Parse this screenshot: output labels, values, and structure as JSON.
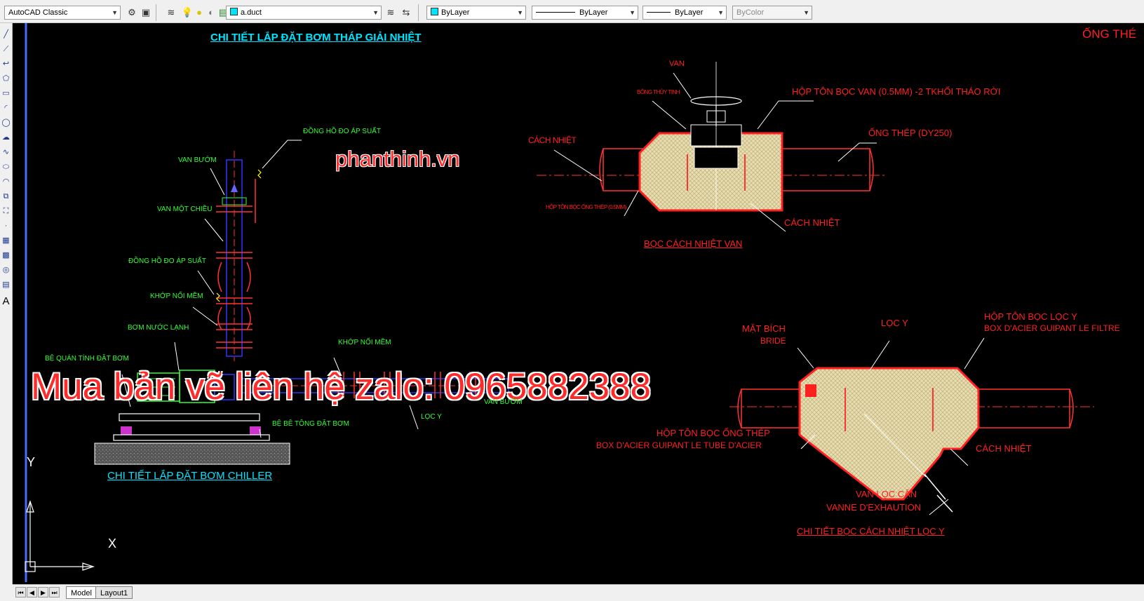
{
  "toolbar": {
    "workspace": "AutoCAD Classic",
    "layer": "a.duct",
    "color": "ByLayer",
    "linetype": "ByLayer",
    "lineweight": "ByLayer",
    "plotstyle": "ByColor"
  },
  "drawing": {
    "title_top_left": "CHI TIẾT LẮP ĐẶT BƠM THÁP GIẢI NHIỆT",
    "title_corner": "ỐNG THÉ",
    "watermark_site": "phanthinh.vn",
    "watermark_contact": "Mua bản vẽ liên hệ zalo: 0965882388",
    "pump_labels": {
      "dong_ho_top": "ĐỒNG HỒ ĐO ÁP SUẤT",
      "van_buom": "VAN BƯỚM",
      "van_mot_chieu": "VAN MỘT CHIỀU",
      "dong_ho_mid": "ĐỒNG HỒ ĐO ÁP SUẤT",
      "khop_noi_mem_1": "KHỚP NỐI MỀM",
      "bom_nuoc_lanh": "BƠM NƯỚC LẠNH",
      "khop_noi_mem_2": "KHỚP NỐI MỀM",
      "be_quan_tinh": "BỆ QUÁN TÍNH ĐẶT BƠM",
      "van_buom_2": "VAN BƯỚM",
      "loc_y": "LỌC Y",
      "be_be_tong": "BỆ BÊ TÔNG ĐẶT BƠM"
    },
    "title_chiller": "CHI TIẾT LẮP ĐẶT BƠM CHILLER",
    "valve_labels": {
      "van": "VAN",
      "bong_thuy_tinh": "BÔNG THỦY TINH",
      "hop_ton_boc_van": "HỘP TÔN BỌC VAN (0.5MM) -2 TKHỐI THÁO RỜI",
      "ong_thep": "ỐNG THÉP (DY250)",
      "cach_nhiet_1": "CÁCH NHIỆT",
      "hop_ton_boc_ong": "HỘP TÔN BỌC ỐNG THÉP (0.5MM)",
      "cach_nhiet_2": "CÁCH NHIỆT"
    },
    "title_valve": "BỌC CÁCH NHIỆT VAN",
    "filter_labels": {
      "mat_bich": "MẶT BÍCH",
      "bride": "BRIDE",
      "loc_y": "LỌC Y",
      "hop_ton_boc_loc_y": "HỘP TÔN BỌC LỌC Y",
      "box_filtre": "BOX D'ACIER GUIPANT LE FILTRE",
      "hop_ton_boc_ong_thep": "HỘP TÔN BỌC ỐNG THÉP",
      "box_tube": "BOX D'ACIER GUIPANT LE TUBE D'ACIER",
      "cach_nhiet": "CÁCH NHIỆT",
      "van_loc_can": "VAN LỌC CẶN",
      "vanne": "VANNE D'EXHAUTION"
    },
    "title_filter": "CHI TIẾT BỌC CÁCH NHIỆT LỌC Y",
    "ucs": {
      "y": "Y",
      "x": "X"
    }
  },
  "tabs": {
    "model": "Model",
    "layout1": "Layout1"
  },
  "colors": {
    "red": "#ff2020",
    "green": "#33ff33",
    "cyan": "#00e5ff",
    "yellow": "#ffff33",
    "blue": "#3333ff"
  }
}
